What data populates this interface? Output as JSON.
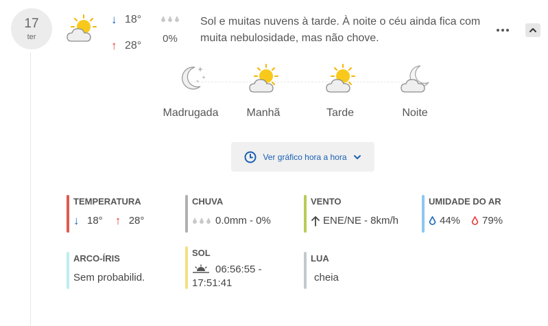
{
  "day": {
    "date": "17",
    "weekday": "ter"
  },
  "summary": {
    "icon": "sun-behind-cloud-icon",
    "min_temp": "18°",
    "max_temp": "28°",
    "rain_pct": "0%",
    "description": "Sol e muitas nuvens à tarde. À noite o céu ainda fica com muita nebulosidade, mas não chove."
  },
  "periods": [
    {
      "label": "Madrugada",
      "icon": "moon-stars-cloud-icon"
    },
    {
      "label": "Manhã",
      "icon": "sun-cloud-icon"
    },
    {
      "label": "Tarde",
      "icon": "sun-cloud-icon"
    },
    {
      "label": "Noite",
      "icon": "moon-cloud-icon"
    }
  ],
  "hourly_button": {
    "label": "Ver gráfico hora a hora"
  },
  "details": {
    "temperature": {
      "title": "TEMPERATURA",
      "min": "18°",
      "max": "28°",
      "color": "#e05a4e"
    },
    "rain": {
      "title": "CHUVA",
      "value": "0.0mm - 0%",
      "color": "#b0b0b0"
    },
    "wind": {
      "title": "VENTO",
      "value": "ENE/NE - 8km/h",
      "color": "#b8cc55"
    },
    "humidity": {
      "title": "UMIDADE DO AR",
      "min": "44%",
      "max": "79%",
      "color": "#8cc8f0"
    },
    "rainbow": {
      "title": "ARCO-ÍRIS",
      "value": "Sem probabilid.",
      "color": "#bdeef0"
    },
    "sun": {
      "title": "SOL",
      "value": "06:56:55 - 17:51:41",
      "color": "#f5de82"
    },
    "moon": {
      "title": "LUA",
      "value": "cheia",
      "color": "#c3c9cc"
    }
  },
  "colors": {
    "accent_blue": "#1a5fb4",
    "down_arrow": "#1565c0",
    "up_arrow": "#e53935"
  }
}
